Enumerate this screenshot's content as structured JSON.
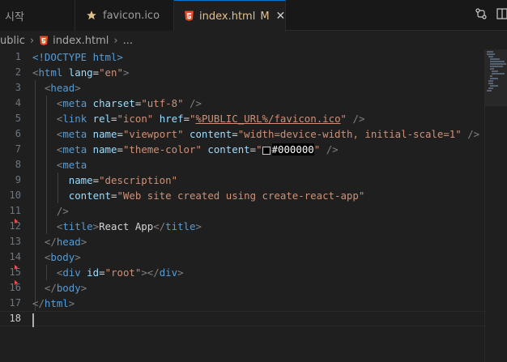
{
  "tabs": [
    {
      "label": "시작",
      "icon": "none"
    },
    {
      "label": "favicon.ico",
      "icon": "star-icon",
      "icon_color": "#e2c08d"
    },
    {
      "label": "index.html",
      "icon": "html5-icon",
      "icon_color": "#e44d26",
      "modified": "M",
      "active": true
    }
  ],
  "breadcrumb": {
    "folder": "ublic",
    "file": "index.html",
    "more": "..."
  },
  "line_numbers": [
    "1",
    "2",
    "3",
    "4",
    "5",
    "6",
    "7",
    "8",
    "9",
    "10",
    "11",
    "12",
    "13",
    "14",
    "15",
    "16",
    "17",
    "18"
  ],
  "active_line": 18,
  "code": {
    "doctype": "<!DOCTYPE html>",
    "html_lang_val": "\"en\"",
    "meta_charset_val": "\"utf-8\"",
    "link_rel_val": "\"icon\"",
    "link_href_val": "%PUBLIC_URL%/favicon.ico",
    "viewport_name_val": "\"viewport\"",
    "viewport_content_val": "\"width=device-width, initial-scale=1\"",
    "theme_name_val": "\"theme-color\"",
    "theme_hex": "#000000",
    "desc_name_val": "\"description\"",
    "desc_content_val": "\"Web site created using create-react-app\"",
    "title_text": "React App",
    "div_id_val": "\"root\""
  },
  "colors": {
    "accent": "#0078d4",
    "modified": "#e2c08d",
    "fold_marker": "#f14c4c"
  }
}
